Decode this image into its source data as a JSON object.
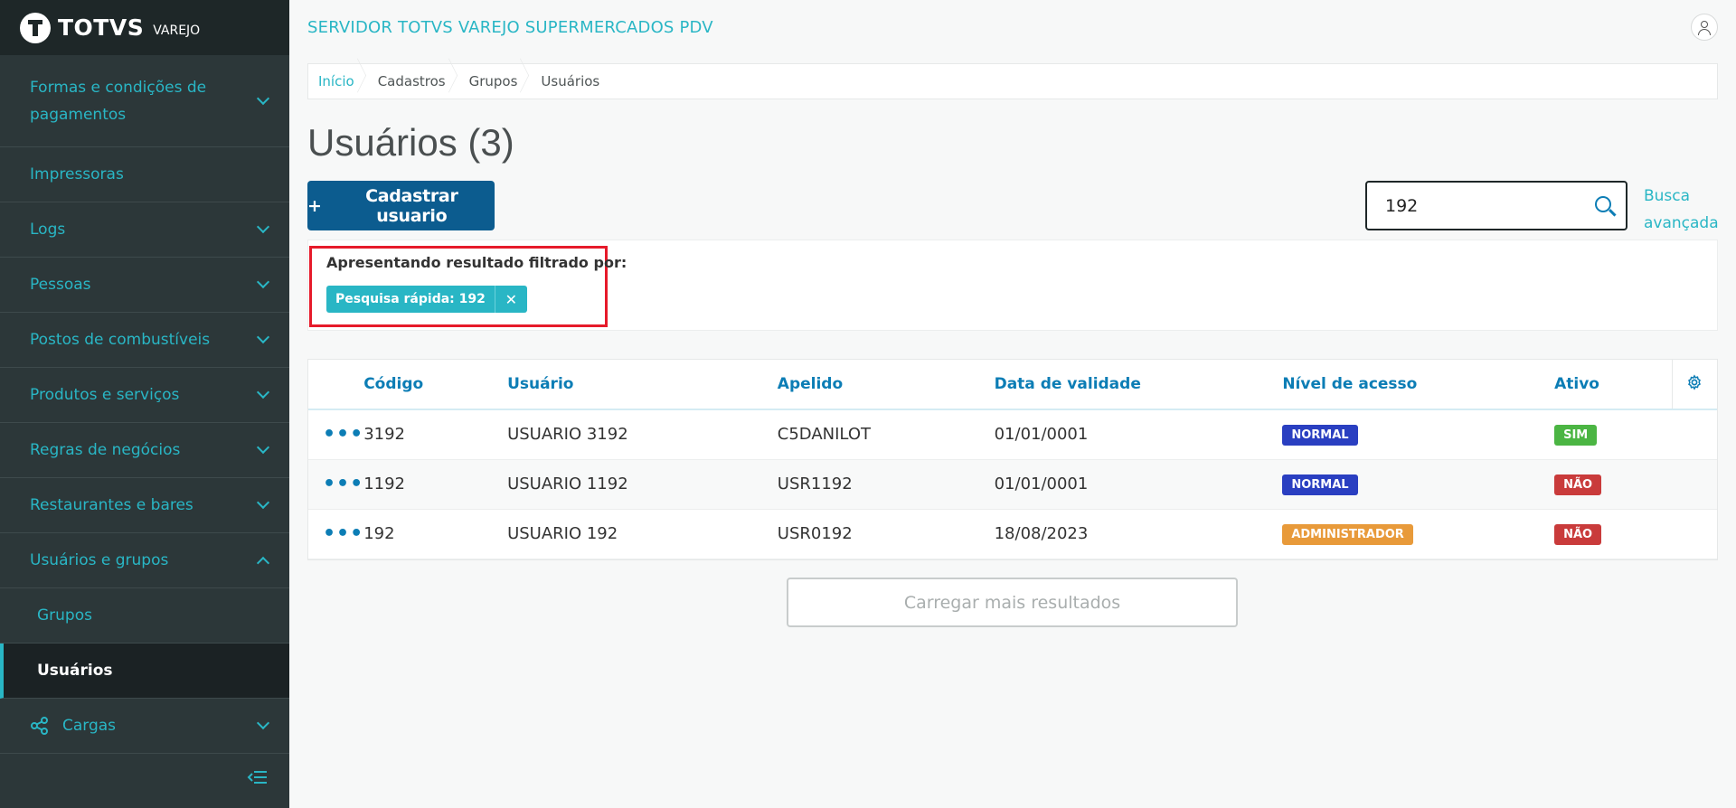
{
  "brand": {
    "name": "TOTVS",
    "sub": "VAREJO"
  },
  "header": {
    "title": "SERVIDOR TOTVS VAREJO SUPERMERCADOS PDV"
  },
  "sidebar": {
    "items": [
      {
        "label": "Formas e condições de pagamentos"
      },
      {
        "label": "Impressoras"
      },
      {
        "label": "Logs"
      },
      {
        "label": "Pessoas"
      },
      {
        "label": "Postos de combustíveis"
      },
      {
        "label": "Produtos e serviços"
      },
      {
        "label": "Regras de negócios"
      },
      {
        "label": "Restaurantes e bares"
      },
      {
        "label": "Usuários e grupos"
      }
    ],
    "sub_items": [
      {
        "label": "Grupos"
      },
      {
        "label": "Usuários"
      }
    ],
    "cargas": {
      "label": "Cargas"
    }
  },
  "breadcrumb": [
    "Início",
    "Cadastros",
    "Grupos",
    "Usuários"
  ],
  "page": {
    "title": "Usuários (3)",
    "add_button_plus": "+",
    "add_button_label": "Cadastrar usuario",
    "search_value": "192",
    "advanced_search": "Busca avançada"
  },
  "filter": {
    "label": "Apresentando resultado filtrado por:",
    "chip": "Pesquisa rápida: 192",
    "chip_close": "✕"
  },
  "table": {
    "columns": [
      "Código",
      "Usuário",
      "Apelido",
      "Data de validade",
      "Nível de acesso",
      "Ativo"
    ],
    "rows": [
      {
        "actions": "•••",
        "codigo": "3192",
        "usuario": "USUARIO 3192",
        "apelido": "C5DANILOT",
        "validade": "01/01/0001",
        "nivel": "NORMAL",
        "ativo": "SIM"
      },
      {
        "actions": "•••",
        "codigo": "1192",
        "usuario": "USUARIO 1192",
        "apelido": "USR1192",
        "validade": "01/01/0001",
        "nivel": "NORMAL",
        "ativo": "NÃO"
      },
      {
        "actions": "•••",
        "codigo": "192",
        "usuario": "USUARIO 192",
        "apelido": "USR0192",
        "validade": "18/08/2023",
        "nivel": "ADMINISTRADOR",
        "ativo": "NÃO"
      }
    ]
  },
  "load_more": "Carregar mais resultados",
  "colors": {
    "accent": "#29b6c5",
    "primary": "#0c5c8f",
    "normal": "#2a3fc1",
    "admin": "#e89a3a",
    "sim": "#4bb543",
    "nao": "#c93b3b",
    "highlight": "#e61a2a"
  }
}
